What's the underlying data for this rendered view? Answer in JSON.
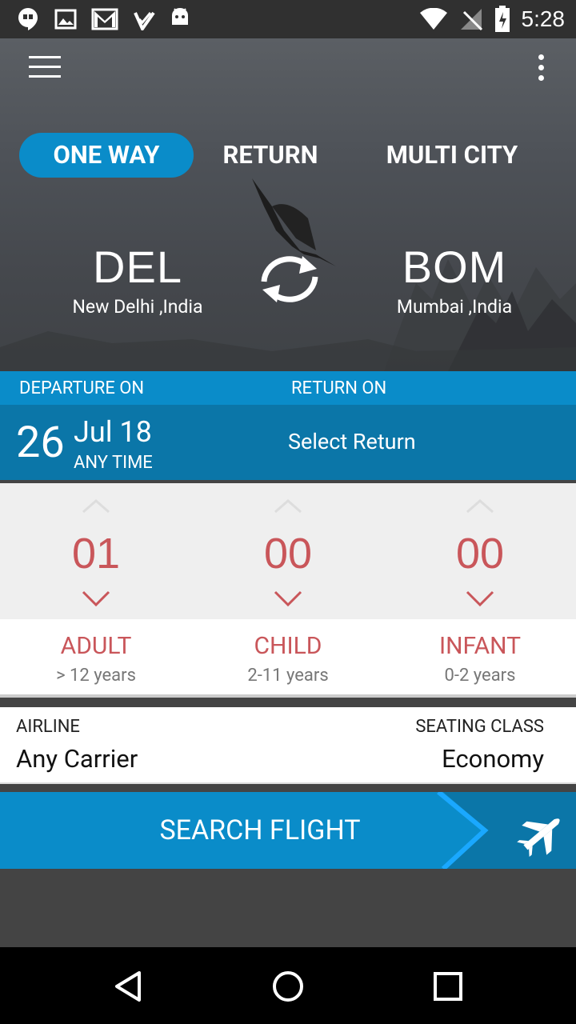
{
  "status_bar": {
    "time": "5:28"
  },
  "trip_tabs": [
    {
      "label": "ONE WAY",
      "active": true
    },
    {
      "label": "RETURN",
      "active": false
    },
    {
      "label": "MULTI CITY",
      "active": false
    }
  ],
  "origin": {
    "code": "DEL",
    "name": "New Delhi ,India"
  },
  "destination": {
    "code": "BOM",
    "name": "Mumbai ,India"
  },
  "dates": {
    "departure_label": "DEPARTURE ON",
    "return_label": "RETURN ON",
    "departure_day": "26",
    "departure_month": "Jul 18",
    "departure_time": "ANY TIME",
    "return_placeholder": "Select Return"
  },
  "passengers": [
    {
      "count": "01",
      "label": "ADULT",
      "sub": "> 12 years"
    },
    {
      "count": "00",
      "label": "CHILD",
      "sub": "2-11 years"
    },
    {
      "count": "00",
      "label": "INFANT",
      "sub": "0-2 years"
    }
  ],
  "airline": {
    "label": "AIRLINE",
    "value": "Any Carrier"
  },
  "seating": {
    "label": "SEATING CLASS",
    "value": "Economy"
  },
  "search_label": "SEARCH FLIGHT",
  "colors": {
    "accent": "#0a8cc9",
    "count_red": "#c9565a"
  }
}
